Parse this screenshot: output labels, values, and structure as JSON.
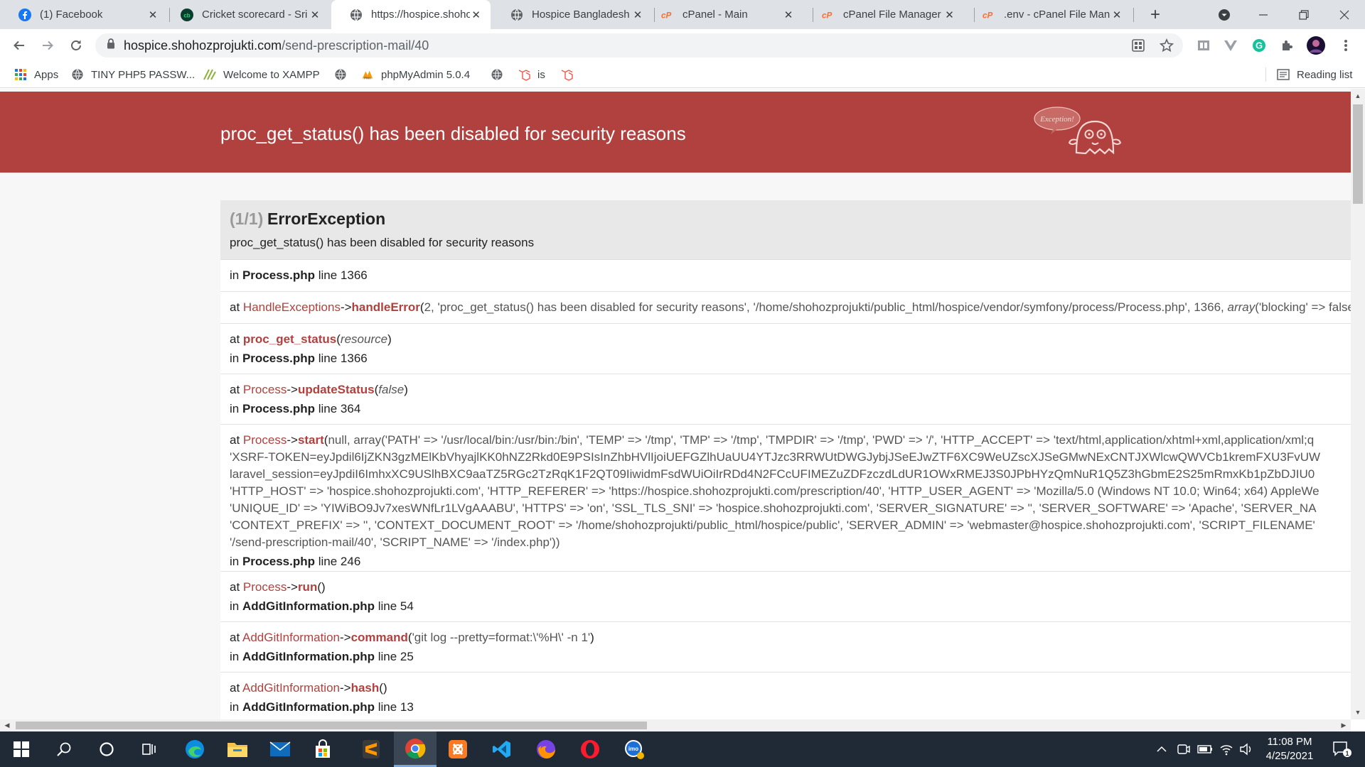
{
  "browser": {
    "tabs": [
      {
        "title": "(1) Facebook",
        "icon": "facebook-icon",
        "active": false
      },
      {
        "title": "Cricket scorecard - Sri",
        "icon": "cricket-icon",
        "active": false
      },
      {
        "title": "https://hospice.shohoz",
        "icon": "globe-icon",
        "active": true
      },
      {
        "title": "Hospice Bangladesh",
        "icon": "globe-icon",
        "active": false
      },
      {
        "title": "cPanel - Main",
        "icon": "cpanel-icon",
        "active": false
      },
      {
        "title": "cPanel File Manager v",
        "icon": "cpanel-icon",
        "active": false
      },
      {
        "title": ".env - cPanel File Man",
        "icon": "cpanel-icon",
        "active": false
      }
    ],
    "new_tab_label": "+",
    "url_host": "hospice.shohozprojukti.com",
    "url_path": "/send-prescription-mail/40",
    "bookmarks": [
      {
        "label": "Apps",
        "icon": "apps-grid-icon"
      },
      {
        "label": "TINY PHP5 PASSW...",
        "icon": "globe-icon"
      },
      {
        "label": "Welcome to XAMPP",
        "icon": "xampp-icon"
      },
      {
        "label": "",
        "icon": "globe-icon"
      },
      {
        "label": "phpMyAdmin 5.0.4",
        "icon": "phpmyadmin-icon"
      },
      {
        "label": "",
        "icon": "globe-icon"
      },
      {
        "label": "is",
        "icon": "laravel-icon"
      },
      {
        "label": "",
        "icon": "laravel-icon"
      }
    ],
    "reading_list": "Reading list"
  },
  "error_page": {
    "header_message": "proc_get_status() has been disabled for security reasons",
    "illustration_text": "Exception!",
    "trace_count": "(1/1)",
    "exception_class": "ErrorException",
    "exception_message": "proc_get_status() has been disabled for security reasons",
    "frames": [
      {
        "in_file": "Process.php",
        "in_line": "line 1366"
      },
      {
        "at_class": "HandleExceptions",
        "at_fn": "handleError",
        "args": "2, 'proc_get_status() has been disabled for security reasons', '/home/shohozprojukti/public_html/hospice/vendor/symfony/process/Process.php', 1366, ",
        "args_it": "array",
        "args_tail": "('blocking' => false, 'running' => true, 'status' => 'running'))"
      },
      {
        "at_fn": "proc_get_status",
        "args_it": "resource",
        "in_file": "Process.php",
        "in_line": "line 1366"
      },
      {
        "at_class": "Process",
        "at_fn": "updateStatus",
        "args_it": "false",
        "in_file": "Process.php",
        "in_line": "line 364"
      },
      {
        "at_class": "Process",
        "at_fn": "start",
        "args_lines": [
          "null, array('PATH' => '/usr/local/bin:/usr/bin:/bin', 'TEMP' => '/tmp', 'TMP' => '/tmp', 'TMPDIR' => '/tmp', 'PWD' => '/', 'HTTP_ACCEPT' => 'text/html,application/xhtml+xml,application/xml;q",
          "'XSRF-TOKEN=eyJpdil6IjZKN3gzMElKbVhyajlKK0hNZ2Rkd0E9PSIsInZhbHVlIjoiUEFGZlhUaUU4YTJzc3RRWUtDWGJybjJSeEJwZTF6XC9WeUZscXJSeGMwNExCNTJXWlcwQWVCb1kremFXU3FvUW",
          "laravel_session=eyJpdiI6ImhxXC9USlhBXC9aaTZ5RGc2TzRqK1F2QT09IiwidmFsdWUiOiIrRDd4N2FCcUFIMEZuZDFzczdLdUR1OWxRMEJ3S0JPbHYzQmNuR1Q5Z3hGbmE2S25mRmxKb1pZbDJIU0",
          "'HTTP_HOST' => 'hospice.shohozprojukti.com', 'HTTP_REFERER' => 'https://hospice.shohozprojukti.com/prescription/40', 'HTTP_USER_AGENT' => 'Mozilla/5.0 (Windows NT 10.0; Win64; x64) AppleWe",
          "'UNIQUE_ID' => 'YIWiBO9Jv7xesWNfLr1LVgAAABU', 'HTTPS' => 'on', 'SSL_TLS_SNI' => 'hospice.shohozprojukti.com', 'SERVER_SIGNATURE' => '', 'SERVER_SOFTWARE' => 'Apache', 'SERVER_NA",
          "'CONTEXT_PREFIX' => '', 'CONTEXT_DOCUMENT_ROOT' => '/home/shohozprojukti/public_html/hospice/public', 'SERVER_ADMIN' => 'webmaster@hospice.shohozprojukti.com', 'SCRIPT_FILENAME'",
          "'/send-prescription-mail/40', 'SCRIPT_NAME' => '/index.php'))"
        ],
        "in_file": "Process.php",
        "in_line": "line 246"
      },
      {
        "at_class": "Process",
        "at_fn": "run",
        "args": "",
        "in_file": "AddGitInformation.php",
        "in_line": "line 54"
      },
      {
        "at_class": "AddGitInformation",
        "at_fn": "command",
        "args": "'git log --pretty=format:\\'%H\\' -n 1'",
        "in_file": "AddGitInformation.php",
        "in_line": "line 25"
      },
      {
        "at_class": "AddGitInformation",
        "at_fn": "hash",
        "args": "",
        "in_file": "AddGitInformation.php",
        "in_line": "line 13"
      }
    ],
    "at_word": "at",
    "in_word": "in",
    "arrow": "->"
  },
  "taskbar": {
    "apps": [
      "windows-start-icon",
      "search-icon",
      "cortana-icon",
      "task-view-icon",
      "edge-icon",
      "file-explorer-icon",
      "mail-icon",
      "store-icon",
      "sublime-icon",
      "chrome-icon",
      "xampp-icon",
      "vscode-icon",
      "firefox-icon",
      "opera-icon",
      "imo-icon"
    ],
    "time": "11:08 PM",
    "date": "4/25/2021",
    "notification_count": "1"
  },
  "colors": {
    "header_red": "#b0413e",
    "tabstrip": "#dee1e6",
    "taskbar": "#202a36"
  }
}
